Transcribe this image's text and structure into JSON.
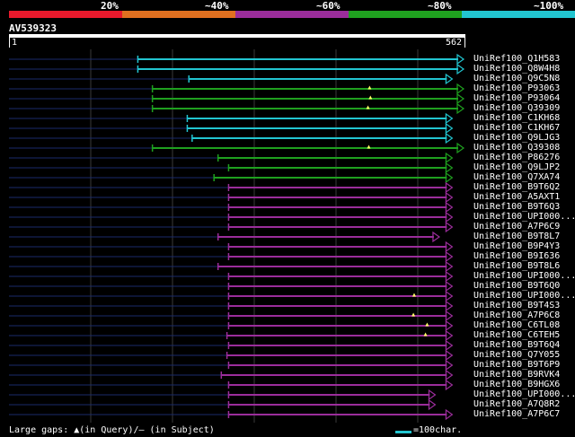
{
  "chart_data": {
    "type": "alignment-overview",
    "query": {
      "name": "AV539323",
      "start": 1,
      "end": 562
    },
    "scale": {
      "labels": [
        "20%",
        "~40%",
        "~60%",
        "~80%",
        "~100%"
      ],
      "colors": [
        "#e8192c",
        "#e07020",
        "#9b2d9b",
        "#1fa01f",
        "#22c5d0"
      ]
    },
    "hits": [
      {
        "name": "UniRef100_Q1H583",
        "start": 160,
        "end": 562,
        "color": "#22c5d0",
        "gap": null
      },
      {
        "name": "UniRef100_Q8W4H8",
        "start": 160,
        "end": 562,
        "color": "#22c5d0",
        "gap": null
      },
      {
        "name": "UniRef100_Q9C5N8",
        "start": 223,
        "end": 548,
        "color": "#22c5d0",
        "gap": null
      },
      {
        "name": "UniRef100_P93063",
        "start": 178,
        "end": 562,
        "color": "#1fa01f",
        "gap": 446
      },
      {
        "name": "UniRef100_P93064",
        "start": 178,
        "end": 562,
        "color": "#1fa01f",
        "gap": 447
      },
      {
        "name": "UniRef100_Q39309",
        "start": 178,
        "end": 562,
        "color": "#1fa01f",
        "gap": 444
      },
      {
        "name": "UniRef100_C1KH68",
        "start": 221,
        "end": 548,
        "color": "#22c5d0",
        "gap": null
      },
      {
        "name": "UniRef100_C1KH67",
        "start": 221,
        "end": 548,
        "color": "#22c5d0",
        "gap": null
      },
      {
        "name": "UniRef100_Q9LJG3",
        "start": 227,
        "end": 548,
        "color": "#22c5d0",
        "gap": null
      },
      {
        "name": "UniRef100_Q39308",
        "start": 178,
        "end": 562,
        "color": "#1fa01f",
        "gap": 445
      },
      {
        "name": "UniRef100_P86276",
        "start": 259,
        "end": 548,
        "color": "#1fa01f",
        "gap": null
      },
      {
        "name": "UniRef100_Q9LJP2",
        "start": 272,
        "end": 548,
        "color": "#1fa01f",
        "gap": null
      },
      {
        "name": "UniRef100_Q7XA74",
        "start": 254,
        "end": 548,
        "color": "#1fa01f",
        "gap": null
      },
      {
        "name": "UniRef100_B9T6Q2",
        "start": 272,
        "end": 548,
        "color": "#9b2d9b",
        "gap": null
      },
      {
        "name": "UniRef100_A5AXT1",
        "start": 272,
        "end": 548,
        "color": "#9b2d9b",
        "gap": null
      },
      {
        "name": "UniRef100_B9T6Q3",
        "start": 272,
        "end": 548,
        "color": "#9b2d9b",
        "gap": null
      },
      {
        "name": "UniRef100_UPI000...",
        "start": 272,
        "end": 548,
        "color": "#9b2d9b",
        "gap": null
      },
      {
        "name": "UniRef100_A7P6C9",
        "start": 272,
        "end": 548,
        "color": "#9b2d9b",
        "gap": null
      },
      {
        "name": "UniRef100_B9T8L7",
        "start": 259,
        "end": 532,
        "color": "#9b2d9b",
        "gap": null
      },
      {
        "name": "UniRef100_B9P4Y3",
        "start": 272,
        "end": 548,
        "color": "#9b2d9b",
        "gap": null
      },
      {
        "name": "UniRef100_B9I636",
        "start": 272,
        "end": 548,
        "color": "#9b2d9b",
        "gap": null
      },
      {
        "name": "UniRef100_B9T8L6",
        "start": 259,
        "end": 548,
        "color": "#9b2d9b",
        "gap": null
      },
      {
        "name": "UniRef100_UPI000...",
        "start": 272,
        "end": 548,
        "color": "#9b2d9b",
        "gap": null
      },
      {
        "name": "UniRef100_B9T6Q0",
        "start": 272,
        "end": 548,
        "color": "#9b2d9b",
        "gap": null
      },
      {
        "name": "UniRef100_UPI000...",
        "start": 272,
        "end": 548,
        "color": "#9b2d9b",
        "gap": 501
      },
      {
        "name": "UniRef100_B9T4S3",
        "start": 272,
        "end": 548,
        "color": "#9b2d9b",
        "gap": null
      },
      {
        "name": "UniRef100_A7P6C8",
        "start": 272,
        "end": 548,
        "color": "#9b2d9b",
        "gap": 500
      },
      {
        "name": "UniRef100_C6TL08",
        "start": 272,
        "end": 548,
        "color": "#9b2d9b",
        "gap": 517
      },
      {
        "name": "UniRef100_C6TEH5",
        "start": 270,
        "end": 548,
        "color": "#9b2d9b",
        "gap": 515
      },
      {
        "name": "UniRef100_B9T6Q4",
        "start": 272,
        "end": 548,
        "color": "#9b2d9b",
        "gap": null
      },
      {
        "name": "UniRef100_Q7Y055",
        "start": 270,
        "end": 548,
        "color": "#9b2d9b",
        "gap": null
      },
      {
        "name": "UniRef100_B9T6P9",
        "start": 272,
        "end": 548,
        "color": "#9b2d9b",
        "gap": null
      },
      {
        "name": "UniRef100_B9RVK4",
        "start": 263,
        "end": 548,
        "color": "#9b2d9b",
        "gap": null
      },
      {
        "name": "UniRef100_B9HGX6",
        "start": 272,
        "end": 548,
        "color": "#9b2d9b",
        "gap": null
      },
      {
        "name": "UniRef100_UPI000...",
        "start": 272,
        "end": 527,
        "color": "#9b2d9b",
        "gap": null
      },
      {
        "name": "UniRef100_A7Q8R2",
        "start": 272,
        "end": 527,
        "color": "#9b2d9b",
        "gap": null
      },
      {
        "name": "UniRef100_A7P6C7",
        "start": 272,
        "end": 548,
        "color": "#9b2d9b",
        "gap": null
      }
    ],
    "grid": true
  },
  "legend": {
    "gaps_text": "Large gaps: ▲(in Query)/– (in Subject)",
    "key_text": "=100char.",
    "key_color": "#22c5d0"
  }
}
